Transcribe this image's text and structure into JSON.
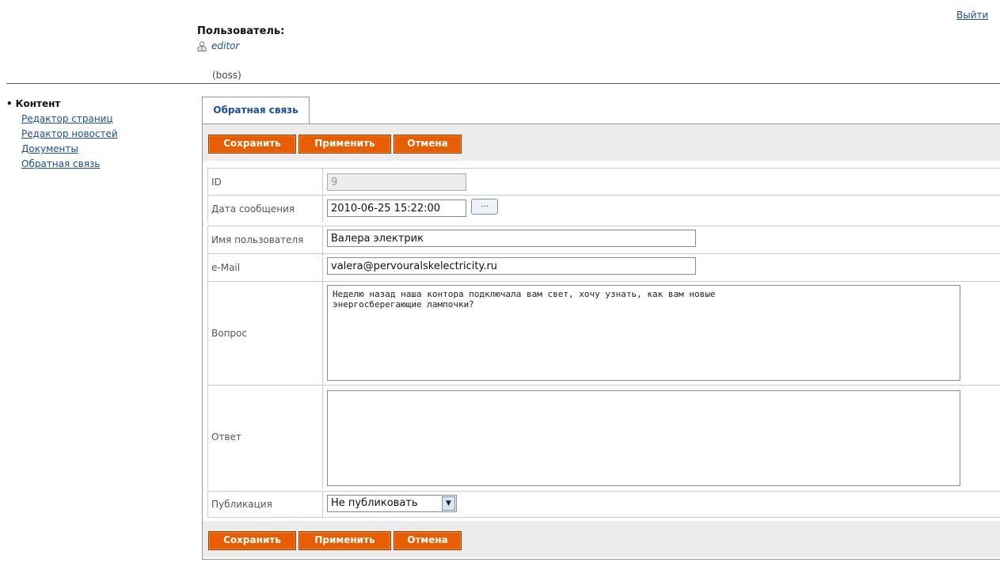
{
  "header": {
    "logout_label": "Выйти",
    "user_label": "Пользователь:",
    "username": "editor",
    "role": "(boss)",
    "user_icon": "user-icon"
  },
  "sidebar": {
    "section": "Контент",
    "items": [
      {
        "label": "Редактор страниц"
      },
      {
        "label": "Редактор новостей"
      },
      {
        "label": "Документы"
      },
      {
        "label": "Обратная связь"
      }
    ]
  },
  "tab": {
    "label": "Обратная связь"
  },
  "toolbar": {
    "save_label": "Сохранить",
    "apply_label": "Применить",
    "cancel_label": "Отмена",
    "accent_color": "#e85d00"
  },
  "form": {
    "id": {
      "label": "ID",
      "value": "9"
    },
    "date": {
      "label": "Дата сообщения",
      "value": "2010-06-25 15:22:00",
      "picker_label": "..."
    },
    "name": {
      "label": "Имя пользователя",
      "value": "Валера электрик"
    },
    "email": {
      "label": "e-Mail",
      "value": "valera@pervouralskelectricity.ru"
    },
    "question": {
      "label": "Вопрос",
      "value": "Неделю назад наша контора подключала вам свет, хочу узнать, как вам новые\nэнергосберегающие лампочки?"
    },
    "answer": {
      "label": "Ответ",
      "value": ""
    },
    "publication": {
      "label": "Публикация",
      "value": "Не публиковать"
    }
  }
}
